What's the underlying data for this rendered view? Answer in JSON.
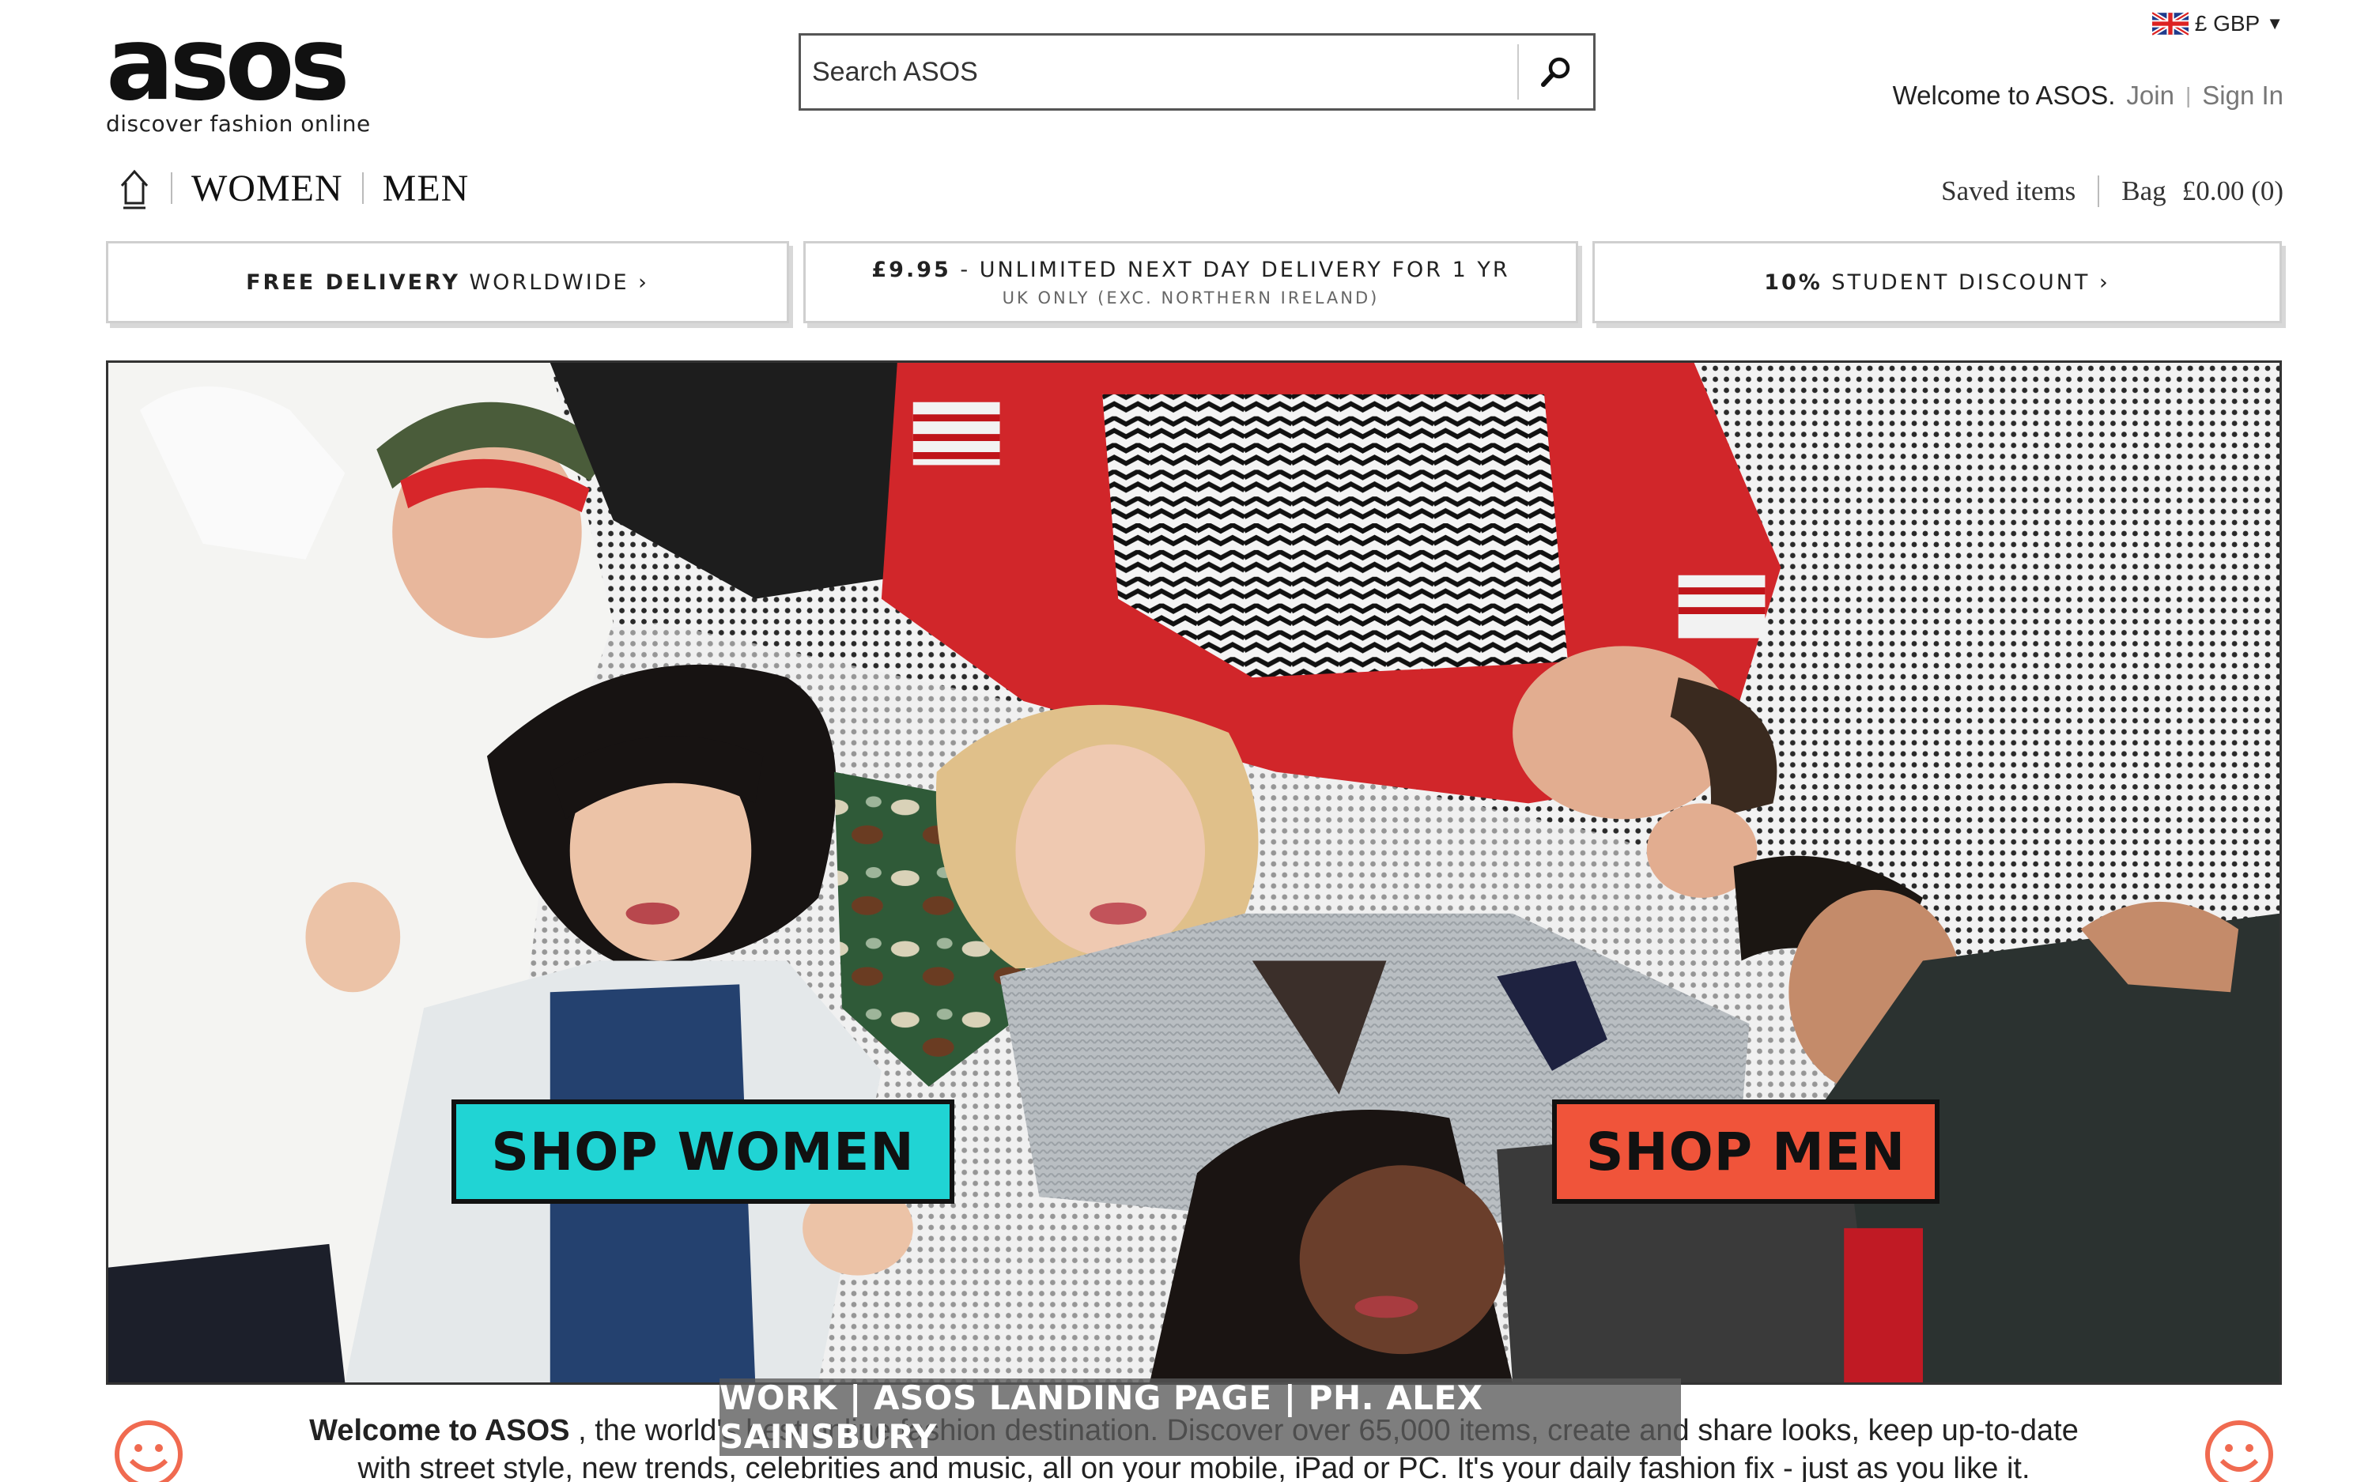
{
  "brand": {
    "logo_text": "asos",
    "tagline": "discover fashion online"
  },
  "search": {
    "placeholder": "Search ASOS",
    "icon": "search-icon"
  },
  "currency": {
    "label": "£ GBP",
    "flag_icon": "uk-flag-icon"
  },
  "account": {
    "welcome": "Welcome to ASOS.",
    "join": "Join",
    "sign_in": "Sign In"
  },
  "nav": {
    "home_icon": "home-icon",
    "tabs": [
      "WOMEN",
      "MEN"
    ]
  },
  "utility": {
    "saved_items": "Saved items",
    "bag_label": "Bag",
    "bag_total": "£0.00 (0)"
  },
  "promos": [
    {
      "bold": "FREE DELIVERY",
      "rest": " WORLDWIDE ›",
      "sub": ""
    },
    {
      "bold": "£9.95",
      "rest": " - UNLIMITED NEXT DAY DELIVERY FOR 1 YR",
      "sub": "UK ONLY (EXC. NORTHERN IRELAND)"
    },
    {
      "bold": "10%",
      "rest": " STUDENT DISCOUNT ›",
      "sub": ""
    }
  ],
  "hero": {
    "shop_women": "SHOP WOMEN",
    "shop_men": "SHOP MEN"
  },
  "footer": {
    "welcome_bold": "Welcome to ASOS",
    "welcome_line1": " , the world's best online fashion destination. Discover over 65,000 items, create and share looks, keep up-to-date",
    "welcome_line2": "with street style, new trends, celebrities and music, all on your mobile, iPad or PC. It's your daily fashion fix - just as you like it.",
    "smiley_icon": "smiley-face-icon"
  },
  "caption": "WORK | ASOS LANDING PAGE | PH. ALEX SAINSBURY",
  "colors": {
    "cta_women": "#20d4d4",
    "cta_men": "#f0543a",
    "smiley": "#f06a50"
  }
}
